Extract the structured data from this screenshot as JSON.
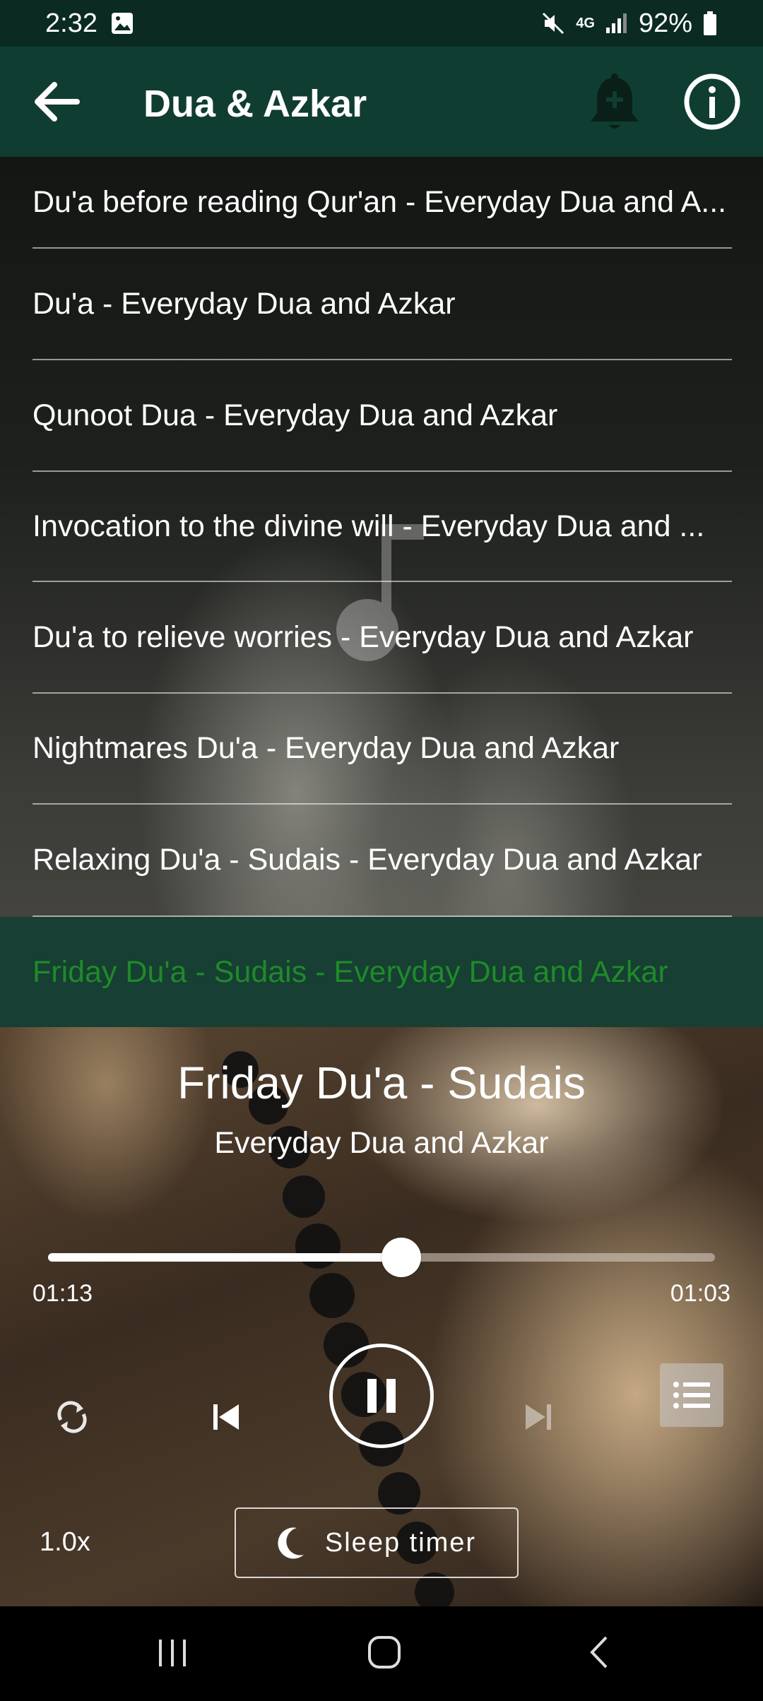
{
  "status_bar": {
    "time": "2:32",
    "network": "4G",
    "battery": "92%"
  },
  "app_bar": {
    "title": "Dua & Azkar"
  },
  "playlist": {
    "items": [
      {
        "label": "Du'a before reading Qur'an - Everyday Dua and A..."
      },
      {
        "label": "Du'a - Everyday Dua and Azkar"
      },
      {
        "label": "Qunoot Dua - Everyday Dua and Azkar"
      },
      {
        "label": "Invocation to the divine will - Everyday Dua and ..."
      },
      {
        "label": "Du'a to relieve worries - Everyday Dua and Azkar"
      },
      {
        "label": "Nightmares Du'a - Everyday Dua and Azkar"
      },
      {
        "label": "Relaxing Du'a - Sudais - Everyday Dua and Azkar"
      }
    ],
    "active_item": "Friday Du'a - Sudais - Everyday Dua and Azkar",
    "active_color": "#1f8a2a"
  },
  "player": {
    "title": "Friday Du'a - Sudais",
    "artist": "Everyday Dua and Azkar",
    "elapsed": "01:13",
    "remaining": "01:03",
    "progress": 0.53,
    "speed": "1.0x",
    "sleep_timer_label": "Sleep timer",
    "icons": {
      "repeat": "repeat-icon",
      "previous": "skip-previous-icon",
      "pause": "pause-icon",
      "next": "skip-next-icon",
      "playlist": "playlist-icon",
      "sleep": "moon-icon"
    }
  },
  "colors": {
    "status_bar_bg": "#0a2a22",
    "app_bar_bg": "#0f3d31",
    "active_row_bg": "#173f33"
  }
}
